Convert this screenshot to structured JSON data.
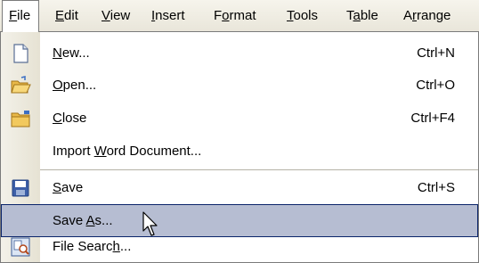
{
  "menubar": {
    "items": [
      {
        "label": "File",
        "access": "F",
        "state": "active"
      },
      {
        "label": "Edit",
        "access": "E"
      },
      {
        "label": "View",
        "access": "V"
      },
      {
        "label": "Insert",
        "access": "I"
      },
      {
        "label": "Format",
        "access": "o"
      },
      {
        "label": "Tools",
        "access": "T"
      },
      {
        "label": "Table",
        "access": "a"
      },
      {
        "label": "Arrange",
        "access": "r"
      }
    ]
  },
  "file_menu": {
    "items": [
      {
        "label": "New...",
        "access": "N",
        "shortcut": "Ctrl+N",
        "icon": "new-document-icon"
      },
      {
        "label": "Open...",
        "access": "O",
        "shortcut": "Ctrl+O",
        "icon": "open-folder-icon"
      },
      {
        "label": "Close",
        "access": "C",
        "shortcut": "Ctrl+F4",
        "icon": "close-folder-icon"
      },
      {
        "label": "Import Word Document...",
        "access": "W",
        "shortcut": "",
        "icon": ""
      },
      {
        "label": "Save",
        "access": "S",
        "shortcut": "Ctrl+S",
        "icon": "save-disk-icon"
      },
      {
        "label": "Save As...",
        "access": "A",
        "shortcut": "",
        "icon": "",
        "state": "highlighted"
      },
      {
        "label": "File Search...",
        "access": "h",
        "shortcut": "",
        "icon": "file-search-icon"
      }
    ]
  },
  "colors": {
    "highlight_fill": "#b6bdd2",
    "highlight_border": "#0a246a",
    "menubar_bg": "#eeece1"
  }
}
